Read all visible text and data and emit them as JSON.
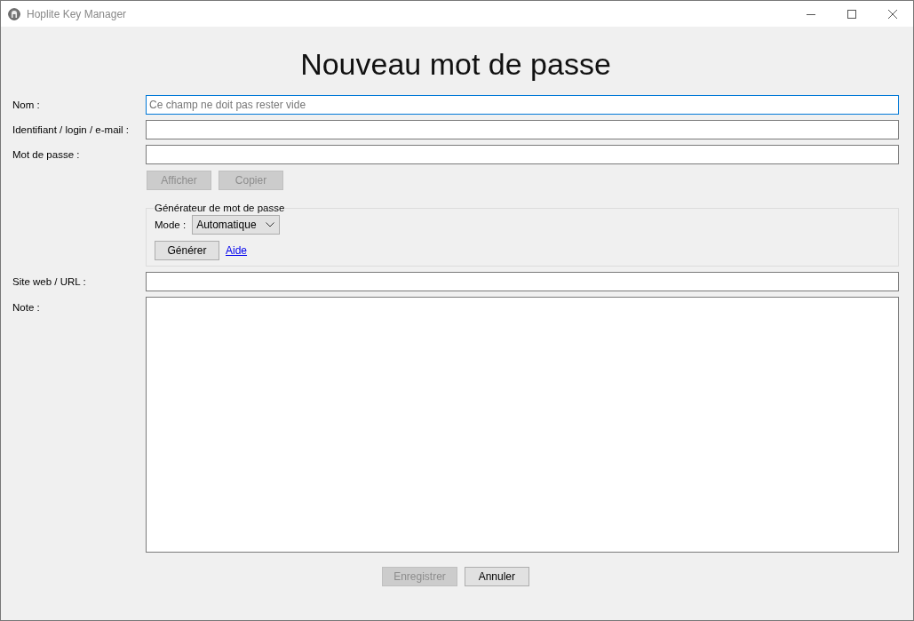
{
  "window": {
    "title": "Hoplite Key Manager"
  },
  "heading": "Nouveau mot de passe",
  "fields": [
    {
      "kind": "line",
      "label": "Nom :",
      "placeholder": "Ce champ ne doit pas rester vide",
      "focused": true
    },
    {
      "kind": "line",
      "label": "Identifiant / login / e-mail :",
      "focused": false
    },
    {
      "kind": "line",
      "label": "Mot de passe :",
      "focused": false
    },
    {
      "kind": "actions",
      "buttons": [
        {
          "label": "Afficher",
          "disabled": true
        },
        {
          "label": "Copier",
          "disabled": true
        }
      ]
    },
    {
      "kind": "generator",
      "title": "Générateur de mot de passe",
      "mode_label": "Mode :",
      "mode_value": "Automatique",
      "button": {
        "label": "Générer",
        "disabled": false
      },
      "link": "Aide"
    },
    {
      "kind": "line",
      "label": "Site web / URL :",
      "focused": false
    },
    {
      "kind": "area",
      "label": "Note :",
      "focused": false
    }
  ],
  "buttons": [
    {
      "label": "Enregistrer",
      "disabled": true
    },
    {
      "label": "Annuler",
      "disabled": false
    }
  ]
}
